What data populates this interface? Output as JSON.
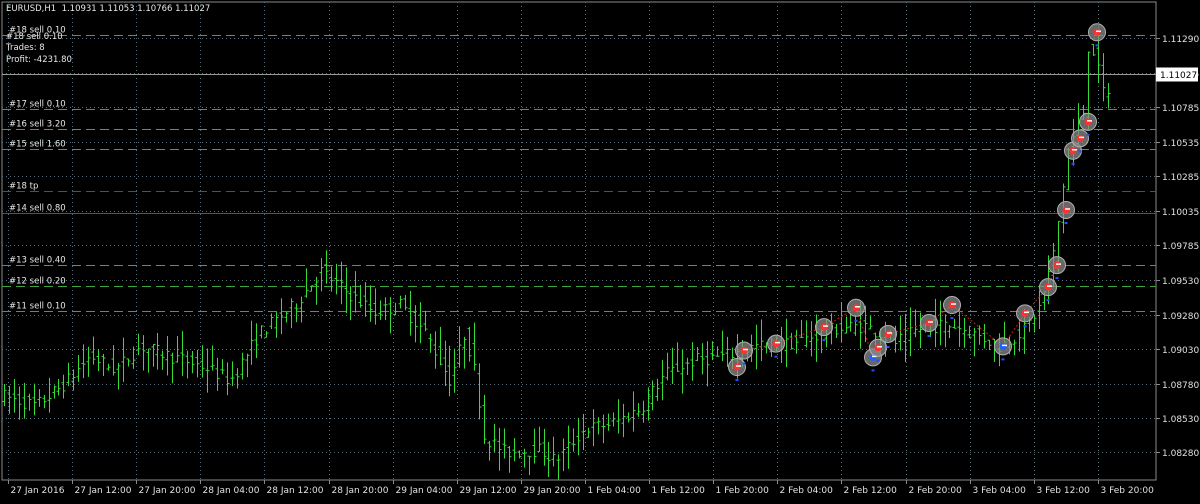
{
  "chart_data": {
    "type": "candlestick",
    "symbol_header": "EURUSD,H1  1.10931 1.11053 1.10766 1.11027",
    "info": {
      "line1": "#18 sell 0.10",
      "line2": "Trades: 8",
      "line3": "Profit: -4231.80"
    },
    "ylim": [
      1.0808,
      1.1155
    ],
    "y_ticks": [
      "1.11290",
      "1.11035",
      "1.10785",
      "1.10535",
      "1.10285",
      "1.10035",
      "1.09785",
      "1.09530",
      "1.09280",
      "1.09030",
      "1.08780",
      "1.08530",
      "1.08280"
    ],
    "x_ticks": [
      "27 Jan 2016",
      "27 Jan 12:00",
      "27 Jan 20:00",
      "28 Jan 04:00",
      "28 Jan 12:00",
      "28 Jan 20:00",
      "29 Jan 04:00",
      "29 Jan 12:00",
      "29 Jan 20:00",
      "1 Feb 04:00",
      "1 Feb 12:00",
      "1 Feb 20:00",
      "2 Feb 04:00",
      "2 Feb 12:00",
      "2 Feb 20:00",
      "3 Feb 04:00",
      "3 Feb 12:00",
      "3 Feb 20:00"
    ],
    "current_price": "1.11027",
    "current_price_value": 1.11027,
    "order_levels": [
      {
        "label": "#18 sell 0.10",
        "price": 1.1131,
        "style": "dash",
        "color": "#3aa83a"
      },
      {
        "label": "#17 sell 0.10",
        "price": 1.1077,
        "style": "dash",
        "color": "#3aa83a"
      },
      {
        "label": "#16 sell 3.20",
        "price": 1.1063,
        "style": "dash",
        "color": "#3aa83a"
      },
      {
        "label": "#15 sell 1.60",
        "price": 1.1048,
        "style": "dash",
        "color": "#3aa83a"
      },
      {
        "label": "#18 tp",
        "price": 1.1018,
        "style": "dash",
        "color": "#c81e1e"
      },
      {
        "label": "#14 sell 0.80",
        "price": 1.1002,
        "style": "solid",
        "color": "#1f7a1f"
      },
      {
        "label": "#13 sell 0.40",
        "price": 1.0964,
        "style": "dash",
        "color": "#3aa83a"
      },
      {
        "label": "#12 sell 0.20",
        "price": 1.0949,
        "style": "dash",
        "color": "#3aa83a"
      },
      {
        "label": "#11 sell 0.10",
        "price": 1.0931,
        "style": "dash",
        "color": "#3aa83a"
      }
    ],
    "trade_markers": [
      {
        "x": 737,
        "price": 1.089
      },
      {
        "x": 744,
        "price": 1.0902
      },
      {
        "x": 776,
        "price": 1.0907
      },
      {
        "x": 824,
        "price": 1.0919
      },
      {
        "x": 856,
        "price": 1.0933
      },
      {
        "x": 873,
        "price": 1.0897
      },
      {
        "x": 878,
        "price": 1.0904
      },
      {
        "x": 888,
        "price": 1.0914
      },
      {
        "x": 929,
        "price": 1.0922
      },
      {
        "x": 952,
        "price": 1.0935
      },
      {
        "x": 1003,
        "price": 1.0905
      },
      {
        "x": 1025,
        "price": 1.0929
      },
      {
        "x": 1048,
        "price": 1.0948
      },
      {
        "x": 1057,
        "price": 1.0964
      },
      {
        "x": 1066,
        "price": 1.1004
      },
      {
        "x": 1073,
        "price": 1.1047
      },
      {
        "x": 1080,
        "price": 1.1056
      },
      {
        "x": 1088,
        "price": 1.1068
      },
      {
        "x": 1097,
        "price": 1.1133
      }
    ],
    "grid": true,
    "colors": {
      "background": "#000000",
      "candle": "#33dd33",
      "grid": "#5a6e77",
      "sell_line": "#3aa83a",
      "tp_line": "#c81e1e"
    }
  }
}
